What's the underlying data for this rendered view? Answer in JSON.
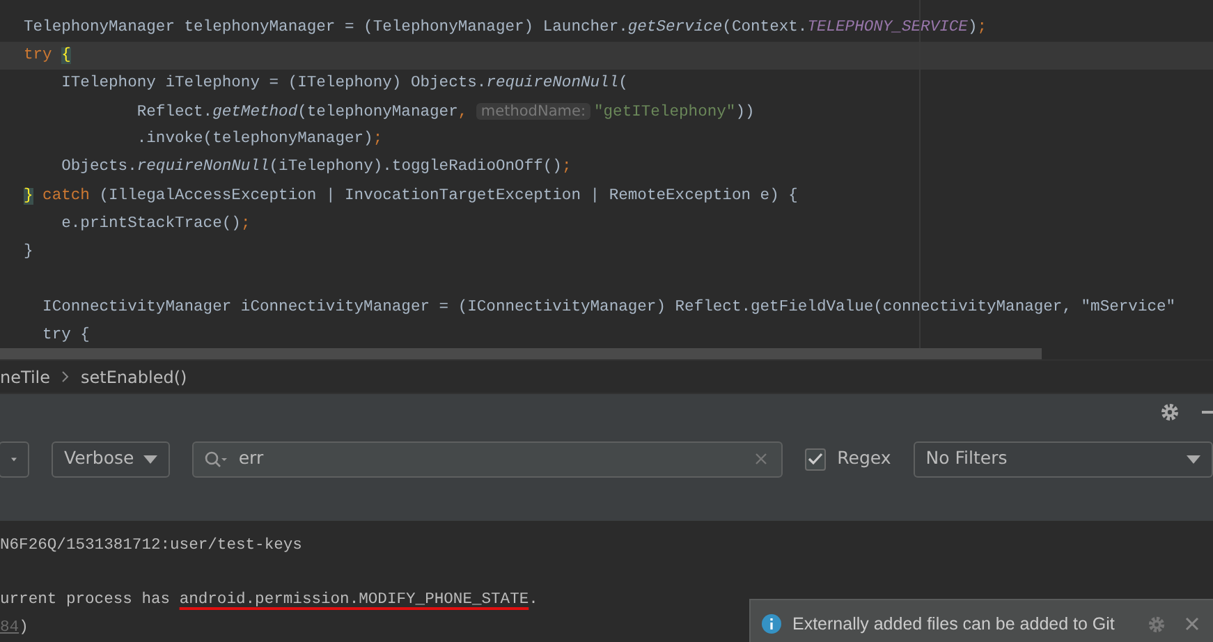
{
  "editor": {
    "lines": [
      {
        "current": false,
        "tokens": [
          {
            "kind": "plain",
            "text": "TelephonyManager telephonyManager = (TelephonyManager) Launcher."
          },
          {
            "kind": "method",
            "text": "getService"
          },
          {
            "kind": "plain",
            "text": "(Context."
          },
          {
            "kind": "constant",
            "text": "TELEPHONY_SERVICE"
          },
          {
            "kind": "plain",
            "text": ")"
          },
          {
            "kind": "keyword",
            "text": ";"
          }
        ]
      },
      {
        "current": true,
        "tokens": [
          {
            "kind": "keyword",
            "text": "try "
          },
          {
            "kind": "brace",
            "text": "{"
          }
        ]
      },
      {
        "current": false,
        "tokens": [
          {
            "kind": "plain",
            "text": "    ITelephony iTelephony = (ITelephony) Objects."
          },
          {
            "kind": "method",
            "text": "requireNonNull"
          },
          {
            "kind": "plain",
            "text": "("
          }
        ]
      },
      {
        "current": false,
        "tokens": [
          {
            "kind": "plain",
            "text": "            Reflect."
          },
          {
            "kind": "method",
            "text": "getMethod"
          },
          {
            "kind": "plain",
            "text": "(telephonyManager"
          },
          {
            "kind": "keyword",
            "text": ", "
          },
          {
            "kind": "hint",
            "text": "methodName:"
          },
          {
            "kind": "string",
            "text": "\"getITelephony\""
          },
          {
            "kind": "plain",
            "text": "))"
          }
        ]
      },
      {
        "current": false,
        "tokens": [
          {
            "kind": "plain",
            "text": "            .invoke(telephonyManager)"
          },
          {
            "kind": "keyword",
            "text": ";"
          }
        ]
      },
      {
        "current": false,
        "tokens": [
          {
            "kind": "plain",
            "text": "    Objects."
          },
          {
            "kind": "method",
            "text": "requireNonNull"
          },
          {
            "kind": "plain",
            "text": "(iTelephony).toggleRadioOnOff()"
          },
          {
            "kind": "keyword",
            "text": ";"
          }
        ]
      },
      {
        "current": false,
        "tokens": [
          {
            "kind": "brace",
            "text": "}"
          },
          {
            "kind": "keyword",
            "text": " catch "
          },
          {
            "kind": "plain",
            "text": "(IllegalAccessException | InvocationTargetException | RemoteException e) {"
          }
        ]
      },
      {
        "current": false,
        "tokens": [
          {
            "kind": "plain",
            "text": "    e.printStackTrace()"
          },
          {
            "kind": "keyword",
            "text": ";"
          }
        ]
      },
      {
        "current": false,
        "tokens": [
          {
            "kind": "plain",
            "text": "}"
          }
        ]
      },
      {
        "current": false
      },
      {
        "current": false,
        "tokens": [
          {
            "kind": "plain",
            "text": "  IConnectivityManager iConnectivityManager = (IConnectivityManager) Reflect.getFieldValue(connectivityManager, \"mService\""
          }
        ]
      },
      {
        "current": false,
        "tokens": [
          {
            "kind": "plain",
            "text": "  try {"
          }
        ]
      }
    ]
  },
  "breadcrumbs": [
    "neTile",
    "setEnabled()"
  ],
  "logcat": {
    "toolbar": {
      "level": "Verbose",
      "search": "err",
      "regex_checked": true,
      "regex_label": "Regex",
      "filter": "No Filters"
    },
    "lines": [
      {
        "tokens": [
          {
            "kind": "plain",
            "text": "N6F26Q/1531381712:user/test-keys"
          }
        ]
      },
      {
        "tokens": [
          {
            "kind": "plain",
            "text": "urrent process has "
          },
          {
            "kind": "marked",
            "text": "android.permission.MODIFY_PHONE_STATE"
          },
          {
            "kind": "plain",
            "text": "."
          }
        ]
      },
      {
        "tokens": [
          {
            "kind": "link",
            "text": "84"
          },
          {
            "kind": "plain",
            "text": ")"
          }
        ]
      }
    ]
  },
  "notification": {
    "text": "Externally added files can be added to Git"
  }
}
